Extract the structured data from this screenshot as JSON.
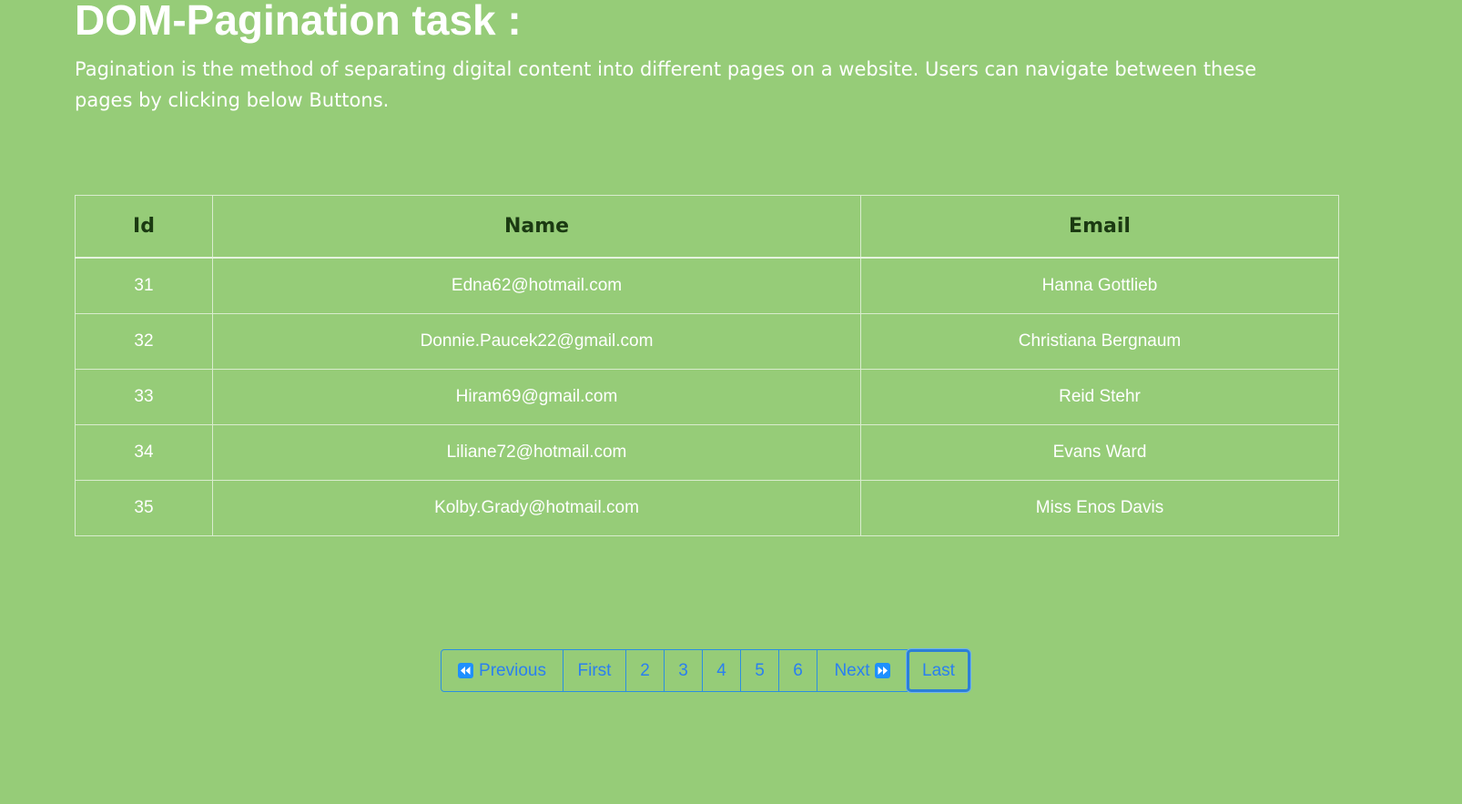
{
  "header": {
    "title": "DOM-Pagination task :",
    "description": "Pagination is the method of separating digital content into different pages on a website. Users can navigate between these pages by clicking below Buttons."
  },
  "table": {
    "columns": [
      "Id",
      "Name",
      "Email"
    ],
    "rows": [
      {
        "id": "31",
        "name": "Edna62@hotmail.com",
        "email": "Hanna Gottlieb"
      },
      {
        "id": "32",
        "name": "Donnie.Paucek22@gmail.com",
        "email": "Christiana Bergnaum"
      },
      {
        "id": "33",
        "name": "Hiram69@gmail.com",
        "email": "Reid Stehr"
      },
      {
        "id": "34",
        "name": "Liliane72@hotmail.com",
        "email": "Evans Ward"
      },
      {
        "id": "35",
        "name": "Kolby.Grady@hotmail.com",
        "email": "Miss Enos Davis"
      }
    ]
  },
  "pagination": {
    "previous_label": "Previous",
    "previous_icon": "rewind-icon",
    "first_label": "First",
    "pages": [
      "2",
      "3",
      "4",
      "5",
      "6"
    ],
    "next_label": "Next",
    "next_icon": "fast-forward-icon",
    "last_label": "Last"
  },
  "colors": {
    "background": "#96cc78",
    "link": "#2a7ff0",
    "header_text": "#1b3a12"
  }
}
